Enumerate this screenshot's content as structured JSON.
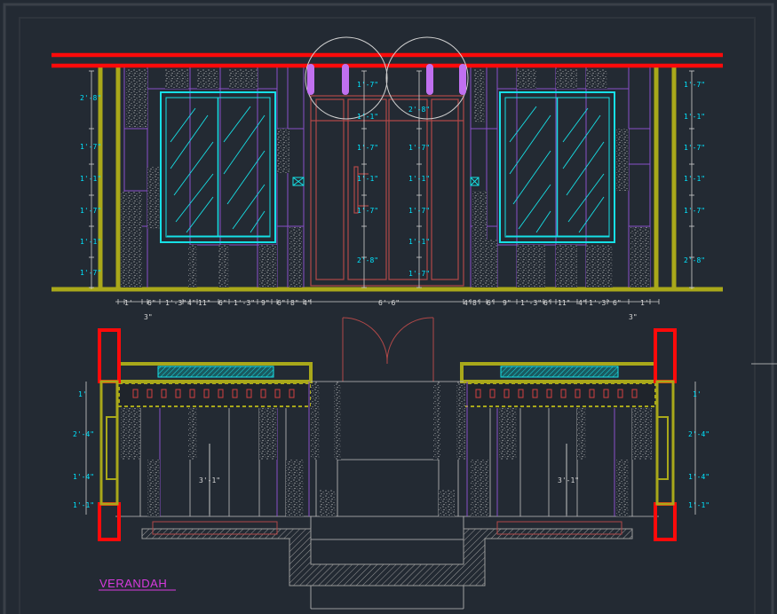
{
  "drawing": {
    "title": "VERANDAH",
    "colors": {
      "background": "#232a33",
      "frame": "#3a4048",
      "beam": "#ff0a0a",
      "pier": "#a9a81a",
      "glazing": "#16e0e6",
      "partition": "#a060e0",
      "door": "#b04848",
      "pendant": "#c070f0",
      "dimension": "#00e5ff",
      "stipple": "#c8c8c8",
      "title": "#d83adf"
    },
    "elevation": {
      "left_dims": [
        "2'-8\"",
        "1'-7\"",
        "1'-1\"",
        "1'-7\"",
        "1'-1\"",
        "1'-7\""
      ],
      "center_left_dims": [
        "1'-7\"",
        "1'-1\"",
        "1'-7\"",
        "1'-1\"",
        "1'-7\"",
        "2'-8\""
      ],
      "center_right_dims": [
        "2'-8\"",
        "1'-7\"",
        "1'-1\"",
        "1'-7\"",
        "1'-1\"",
        "1'-7\""
      ],
      "right_dims": [
        "1'-7\"",
        "1'-1\"",
        "1'-7\"",
        "1'-1\"",
        "1'-7\"",
        "2'-8\""
      ],
      "bottom_dims_left": [
        "1'",
        "6\"",
        "1'-3\"",
        "4\"",
        "11\"",
        "6\"",
        "1'-3\"",
        "9\"",
        "6\"",
        "8\"",
        "4\""
      ],
      "bottom_dim_center": "6'-6\"",
      "bottom_dims_right": [
        "4\"",
        "8\"",
        "6\"",
        "9\"",
        "1'-3\"",
        "6\"",
        "11\"",
        "4\"",
        "1'-3\"",
        "6\"",
        "1'"
      ],
      "sub_dim_left": "3\"",
      "sub_dim_right": "3\""
    },
    "section": {
      "left_dims": [
        "1'",
        "2'-4\"",
        "1'-4\"",
        "1'-1\""
      ],
      "right_dims": [
        "1'",
        "2'-4\"",
        "1'-4\"",
        "1'-1\""
      ],
      "inner_dim_left": "3'-1\"",
      "inner_dim_right": "3'-1\""
    }
  }
}
